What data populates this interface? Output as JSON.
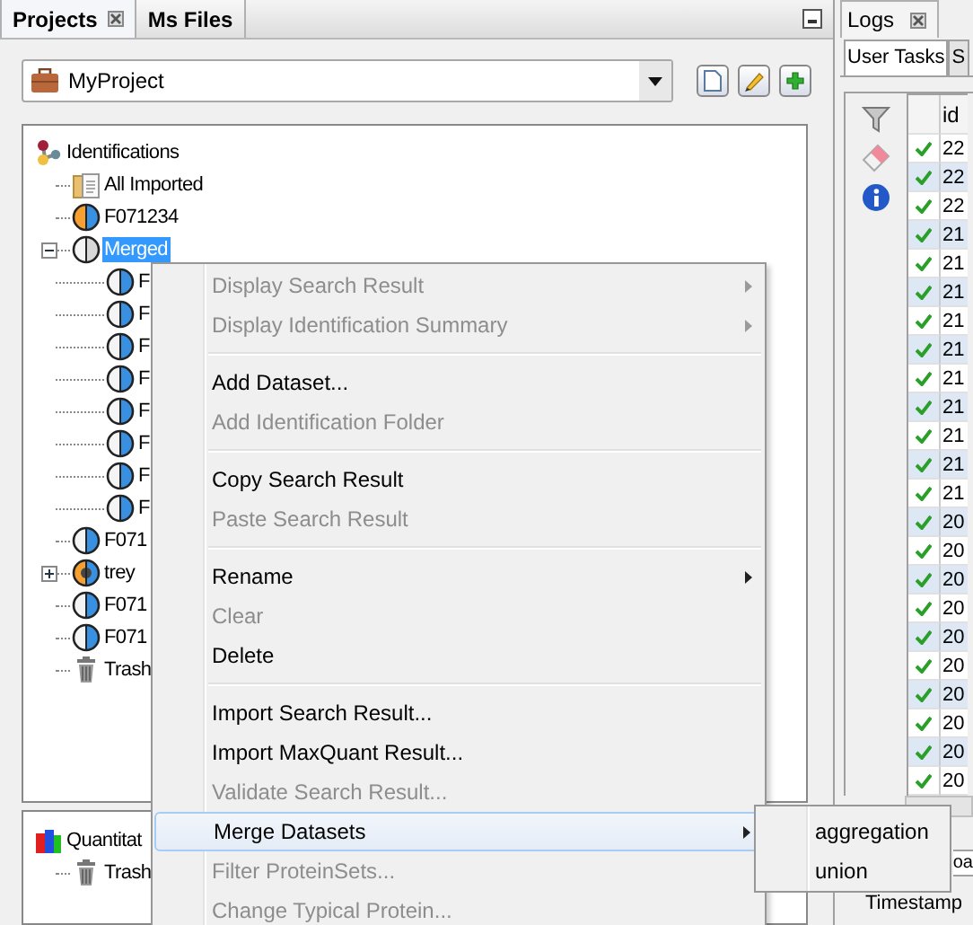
{
  "left_panel": {
    "tabs": [
      {
        "label": "Projects",
        "selected": true,
        "closable": true
      },
      {
        "label": "Ms Files",
        "selected": false,
        "closable": false
      }
    ],
    "project": {
      "value": "MyProject"
    },
    "tree": [
      {
        "label": "Identifications",
        "kind": "identifications",
        "selected": false,
        "children": [
          {
            "label": "All Imported",
            "kind": "all-imported",
            "selected": false
          },
          {
            "label": "F071234",
            "kind": "dataset-orange",
            "selected": false
          },
          {
            "label": "Merged",
            "kind": "merged",
            "selected": true,
            "expanded": true,
            "children": [
              {
                "label": "F",
                "kind": "dataset",
                "selected": false
              },
              {
                "label": "F",
                "kind": "dataset",
                "selected": false
              },
              {
                "label": "F",
                "kind": "dataset",
                "selected": false
              },
              {
                "label": "F",
                "kind": "dataset",
                "selected": false
              },
              {
                "label": "F",
                "kind": "dataset",
                "selected": false
              },
              {
                "label": "F",
                "kind": "dataset",
                "selected": false
              },
              {
                "label": "F",
                "kind": "dataset",
                "selected": false
              },
              {
                "label": "F",
                "kind": "dataset",
                "selected": false
              }
            ]
          },
          {
            "label": "F071",
            "kind": "dataset",
            "selected": false
          },
          {
            "label": "trey",
            "kind": "aggregation",
            "selected": false,
            "expanded": false
          },
          {
            "label": "F071",
            "kind": "dataset",
            "selected": false
          },
          {
            "label": "F071",
            "kind": "dataset",
            "selected": false
          },
          {
            "label": "Trash",
            "kind": "trash",
            "selected": false
          }
        ]
      }
    ],
    "quantitation_tree": [
      {
        "label": "Quantitat",
        "kind": "quantitations",
        "selected": false,
        "children": [
          {
            "label": "Trash",
            "kind": "trash",
            "selected": false
          }
        ]
      }
    ]
  },
  "right_panel": {
    "tab": {
      "label": "Logs"
    },
    "subtabs": [
      {
        "label": "User Tasks",
        "selected": true
      },
      {
        "label": "S",
        "selected": false
      }
    ],
    "table": {
      "columns": [
        "id"
      ],
      "rows": [
        {
          "done": true,
          "id": "22"
        },
        {
          "done": true,
          "id": "22"
        },
        {
          "done": true,
          "id": "22"
        },
        {
          "done": true,
          "id": "21"
        },
        {
          "done": true,
          "id": "21"
        },
        {
          "done": true,
          "id": "21"
        },
        {
          "done": true,
          "id": "21"
        },
        {
          "done": true,
          "id": "21"
        },
        {
          "done": true,
          "id": "21"
        },
        {
          "done": true,
          "id": "21"
        },
        {
          "done": true,
          "id": "21"
        },
        {
          "done": true,
          "id": "21"
        },
        {
          "done": true,
          "id": "21"
        },
        {
          "done": true,
          "id": "20"
        },
        {
          "done": true,
          "id": "20"
        },
        {
          "done": true,
          "id": "20"
        },
        {
          "done": true,
          "id": "20"
        },
        {
          "done": true,
          "id": "20"
        },
        {
          "done": true,
          "id": "20"
        },
        {
          "done": true,
          "id": "20"
        },
        {
          "done": true,
          "id": "20"
        },
        {
          "done": true,
          "id": "20"
        },
        {
          "done": true,
          "id": "20"
        }
      ]
    },
    "lower_tab": {
      "label": "oa"
    },
    "lower_column": {
      "label": "Timestamp"
    }
  },
  "context_menu": {
    "groups": [
      [
        {
          "label": "Display Search Result",
          "disabled": true,
          "submenu": true,
          "selected": false
        },
        {
          "label": "Display Identification Summary",
          "disabled": true,
          "submenu": true,
          "selected": false
        }
      ],
      [
        {
          "label": "Add Dataset...",
          "disabled": false,
          "submenu": false,
          "selected": false
        },
        {
          "label": "Add Identification Folder",
          "disabled": true,
          "submenu": false,
          "selected": false
        }
      ],
      [
        {
          "label": "Copy Search Result",
          "disabled": false,
          "submenu": false,
          "selected": false
        },
        {
          "label": "Paste Search Result",
          "disabled": true,
          "submenu": false,
          "selected": false
        }
      ],
      [
        {
          "label": "Rename",
          "disabled": false,
          "submenu": true,
          "selected": false
        },
        {
          "label": "Clear",
          "disabled": true,
          "submenu": false,
          "selected": false
        },
        {
          "label": "Delete",
          "disabled": false,
          "submenu": false,
          "selected": false
        }
      ],
      [
        {
          "label": "Import Search Result...",
          "disabled": false,
          "submenu": false,
          "selected": false
        },
        {
          "label": "Import MaxQuant Result...",
          "disabled": false,
          "submenu": false,
          "selected": false
        },
        {
          "label": "Validate Search Result...",
          "disabled": true,
          "submenu": false,
          "selected": false
        },
        {
          "label": "Merge Datasets",
          "disabled": false,
          "submenu": true,
          "selected": true
        },
        {
          "label": "Filter ProteinSets...",
          "disabled": true,
          "submenu": false,
          "selected": false
        },
        {
          "label": "Change Typical Protein...",
          "disabled": true,
          "submenu": false,
          "selected": false
        }
      ]
    ]
  },
  "submenu": {
    "items": [
      {
        "label": "aggregation",
        "selected": false
      },
      {
        "label": "union",
        "selected": false
      }
    ]
  }
}
